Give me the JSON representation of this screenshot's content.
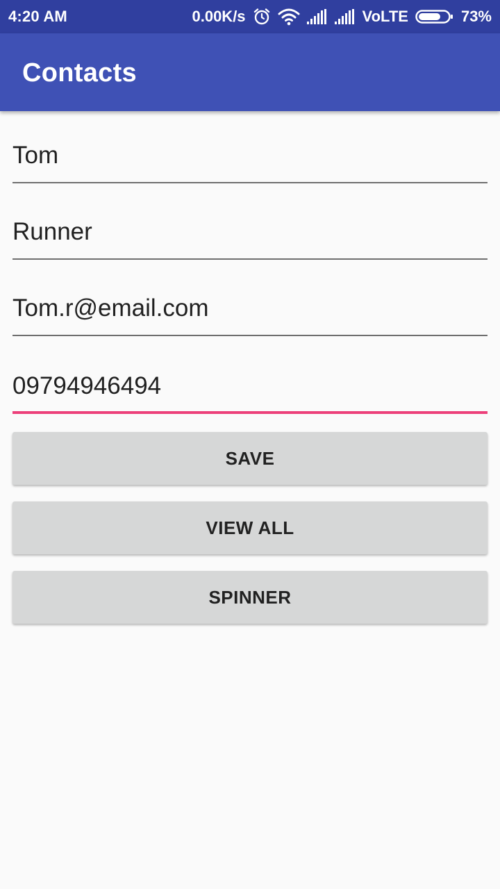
{
  "status_bar": {
    "time": "4:20 AM",
    "network_speed": "0.00K/s",
    "network_type": "VoLTE",
    "battery_percent": "73%",
    "battery_level": 0.73,
    "icons": [
      "alarm-icon",
      "wifi-icon",
      "signal-icon",
      "signal-icon",
      "battery-icon"
    ]
  },
  "app_bar": {
    "title": "Contacts"
  },
  "form": {
    "first_name": {
      "value": "Tom",
      "placeholder": ""
    },
    "last_name": {
      "value": "Runner",
      "placeholder": ""
    },
    "email": {
      "value": "Tom.r@email.com",
      "placeholder": ""
    },
    "phone": {
      "value": "09794946494",
      "placeholder": "",
      "focused": true
    }
  },
  "buttons": {
    "save": "SAVE",
    "view_all": "VIEW ALL",
    "spinner": "SPINNER"
  },
  "colors": {
    "status_bar": "#303f9f",
    "primary": "#3f51b5",
    "accent": "#ec407a",
    "background": "#fafafa",
    "button": "#d6d7d7"
  }
}
